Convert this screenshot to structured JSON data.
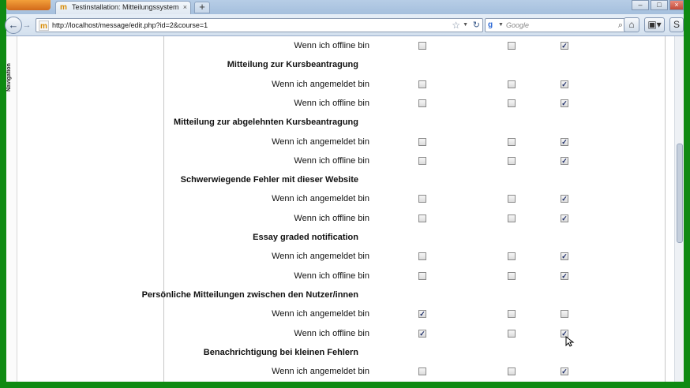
{
  "browser": {
    "tab_title": "Testinstallation: Mitteilungssystem",
    "new_tab_label": "+",
    "url": "http://localhost/message/edit.php?id=2&course=1",
    "search_placeholder": "Google",
    "back_icon": "back-arrow-icon",
    "forward_icon": "forward-arrow-icon",
    "home_icon": "home-icon",
    "bookmark_icon": "star-icon",
    "reload_icon": "reload-icon"
  },
  "sidebar": {
    "label": "Navigation"
  },
  "sections": [
    {
      "title": null,
      "rows": [
        {
          "label": "Wenn ich offline bin",
          "c1": false,
          "c2": false,
          "c3": true
        }
      ]
    },
    {
      "title": "Mitteilung zur Kursbeantragung",
      "rows": [
        {
          "label": "Wenn ich angemeldet bin",
          "c1": false,
          "c2": false,
          "c3": true
        },
        {
          "label": "Wenn ich offline bin",
          "c1": false,
          "c2": false,
          "c3": true
        }
      ]
    },
    {
      "title": "Mitteilung zur abgelehnten Kursbeantragung",
      "rows": [
        {
          "label": "Wenn ich angemeldet bin",
          "c1": false,
          "c2": false,
          "c3": true
        },
        {
          "label": "Wenn ich offline bin",
          "c1": false,
          "c2": false,
          "c3": true
        }
      ]
    },
    {
      "title": "Schwerwiegende Fehler mit dieser Website",
      "rows": [
        {
          "label": "Wenn ich angemeldet bin",
          "c1": false,
          "c2": false,
          "c3": true
        },
        {
          "label": "Wenn ich offline bin",
          "c1": false,
          "c2": false,
          "c3": true
        }
      ]
    },
    {
      "title": "Essay graded notification",
      "rows": [
        {
          "label": "Wenn ich angemeldet bin",
          "c1": false,
          "c2": false,
          "c3": true
        },
        {
          "label": "Wenn ich offline bin",
          "c1": false,
          "c2": false,
          "c3": true
        }
      ]
    },
    {
      "title": "Persönliche Mitteilungen zwischen den Nutzer/innen",
      "rows": [
        {
          "label": "Wenn ich angemeldet bin",
          "c1": true,
          "c2": false,
          "c3": false
        },
        {
          "label": "Wenn ich offline bin",
          "c1": true,
          "c2": false,
          "c3": true
        }
      ]
    },
    {
      "title": "Benachrichtigung bei kleinen Fehlern",
      "rows": [
        {
          "label": "Wenn ich angemeldet bin",
          "c1": false,
          "c2": false,
          "c3": true
        }
      ]
    }
  ],
  "colors": {
    "frame": "#0f8a12",
    "checkmark": "#1a2a66"
  }
}
